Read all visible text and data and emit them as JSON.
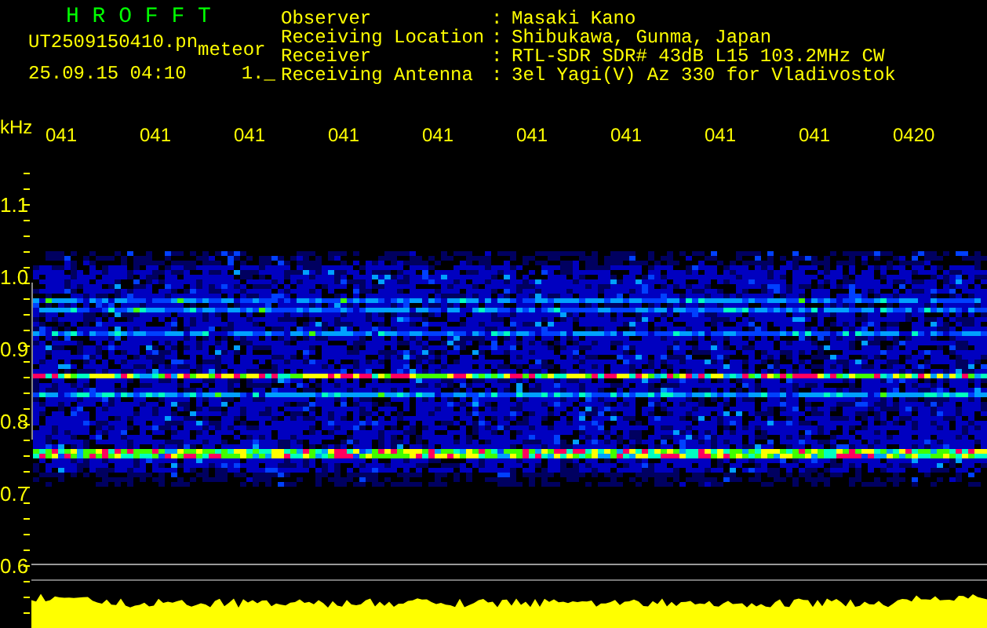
{
  "header": {
    "title": "H R O F F T",
    "file": "UT2509150410.pn",
    "mode": "meteor",
    "timestamp": "25.09.15 04:10",
    "code": "1._"
  },
  "info": [
    {
      "label": "Observer",
      "value": "Masaki Kano"
    },
    {
      "label": "Receiving Location",
      "value": "Shibukawa, Gunma, Japan"
    },
    {
      "label": "Receiver",
      "value": "RTL-SDR SDR# 43dB L15 103.2MHz CW"
    },
    {
      "label": "Receiving Antenna",
      "value": "3el Yagi(V) Az 330 for Vladivostok"
    }
  ],
  "separator": ":",
  "y_axis": {
    "unit": "kHz",
    "ticks": [
      "1.1",
      "1.0",
      "0.9",
      "0.8",
      "0.7",
      "0.6"
    ]
  },
  "time_labels": [
    "041",
    "041",
    "041",
    "041",
    "041",
    "041",
    "041",
    "041",
    "041",
    "0420"
  ]
}
